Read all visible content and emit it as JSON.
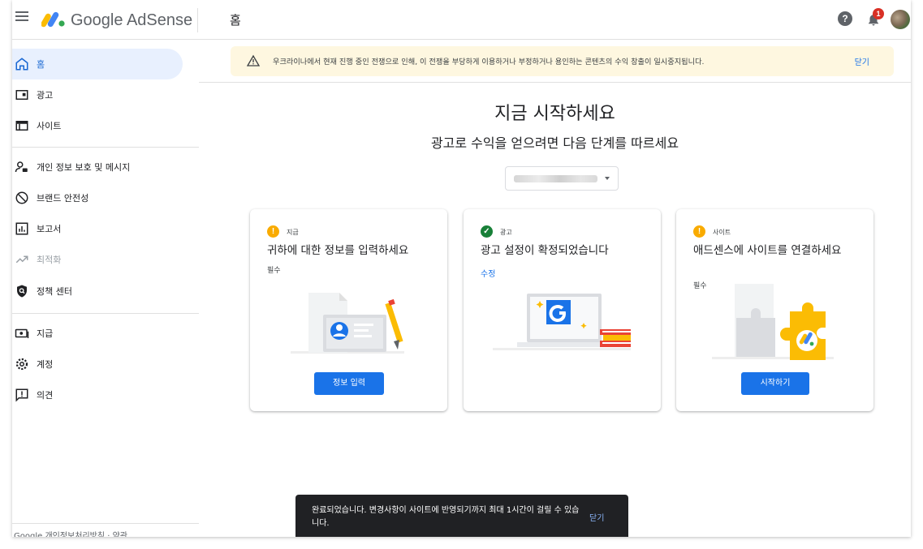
{
  "app": {
    "brand": "Google AdSense",
    "page_title": "홈",
    "notification_count": "1"
  },
  "sidebar": {
    "items": [
      {
        "label": "홈",
        "icon": "home-icon"
      },
      {
        "label": "광고",
        "icon": "ads-icon"
      },
      {
        "label": "사이트",
        "icon": "sites-icon"
      },
      {
        "label": "개인 정보 보호 및 메시지",
        "icon": "privacy-messaging-icon"
      },
      {
        "label": "브랜드 안전성",
        "icon": "brand-safety-icon"
      },
      {
        "label": "보고서",
        "icon": "reports-icon"
      },
      {
        "label": "최적화",
        "icon": "optimization-icon"
      },
      {
        "label": "정책 센터",
        "icon": "policy-center-icon"
      },
      {
        "label": "지급",
        "icon": "payments-icon"
      },
      {
        "label": "계정",
        "icon": "account-gear-icon"
      },
      {
        "label": "의견",
        "icon": "feedback-icon"
      }
    ],
    "footer_cut": "Google  개인정보처리방침 · 약관"
  },
  "banner": {
    "message": "우크라이나에서 현재 진행 중인 전쟁으로 인해, 이 전쟁을 부당하게 이용하거나 부정하거나 용인하는 콘텐츠의 수익 창출이 일시중지됩니다.",
    "close": "닫기"
  },
  "main": {
    "heading": "지금 시작하세요",
    "subheading": "광고로 수익을 얻으려면 다음 단계를 따르세요"
  },
  "cards": [
    {
      "kicker": "지급",
      "title": "귀하에 대한 정보를 입력하세요",
      "sub": "필수",
      "button": "정보 입력",
      "status": "warning"
    },
    {
      "kicker": "광고",
      "title": "광고 설정이 확정되었습니다",
      "link": "수정",
      "status": "complete"
    },
    {
      "kicker": "사이트",
      "title": "애드센스에 사이트를 연결하세요",
      "sub": "필수",
      "button": "시작하기",
      "status": "warning"
    }
  ],
  "snackbar": {
    "message": "완료되었습니다. 변경사항이 사이트에 반영되기까지 최대 1시간이 걸릴 수 있습니다.",
    "action": "닫기"
  },
  "colors": {
    "accent": "#1a73e8",
    "active_bg": "#e8f0fe",
    "warning": "#f9ab00",
    "success": "#188038",
    "banner_bg": "#fef7e0"
  }
}
